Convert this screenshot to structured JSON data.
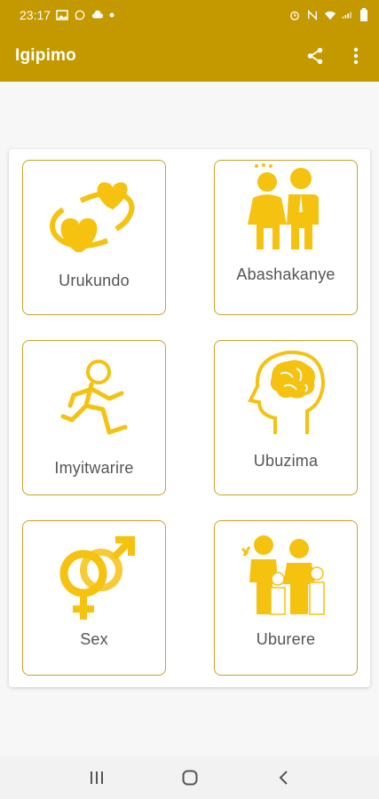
{
  "status_bar": {
    "time": "23:17",
    "left_icons": [
      "image-icon",
      "whatsapp-icon",
      "cloud-icon",
      "dot-icon"
    ],
    "right_icons": [
      "alarm-icon",
      "nfc-icon",
      "wifi-icon",
      "signal-icon",
      "battery-icon"
    ]
  },
  "app_bar": {
    "title": "Igipimo",
    "actions": [
      "share-icon",
      "more-vert-icon"
    ]
  },
  "tiles": [
    {
      "label": "Urukundo",
      "icon": "hearts-icon"
    },
    {
      "label": "Abashakanye",
      "icon": "couple-icon"
    },
    {
      "label": "Imyitwarire",
      "icon": "running-person-icon"
    },
    {
      "label": "Ubuzima",
      "icon": "head-brain-icon"
    },
    {
      "label": "Sex",
      "icon": "gender-symbols-icon"
    },
    {
      "label": "Uburere",
      "icon": "family-icon"
    }
  ],
  "nav_bar": {
    "buttons": [
      "recents-icon",
      "home-icon",
      "back-icon"
    ]
  },
  "colors": {
    "primary": "#c49900",
    "accent": "#f5c20f",
    "tile_border": "#c9a227",
    "label_text": "#555555"
  }
}
